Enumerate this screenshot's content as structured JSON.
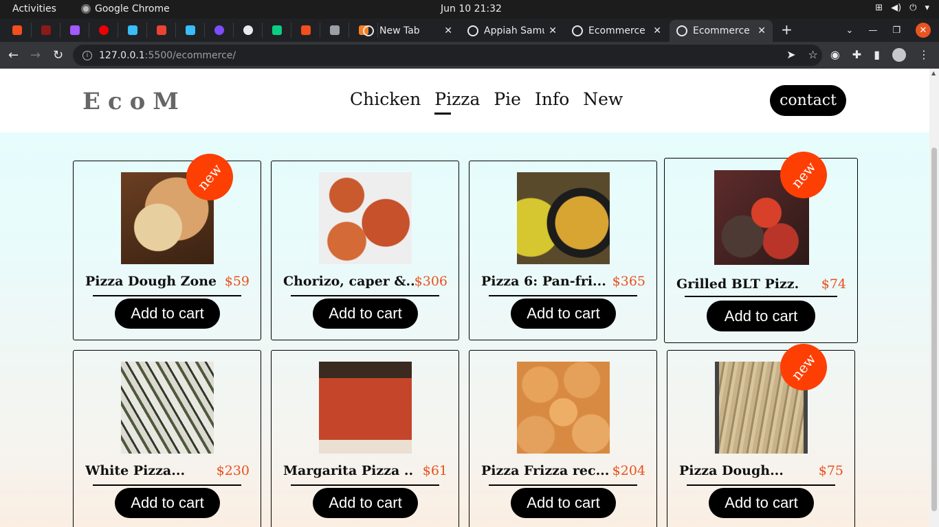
{
  "os_bar": {
    "activities": "Activities",
    "app_name": "Google Chrome",
    "clock": "Jun 10  21:32"
  },
  "browser": {
    "tabs": [
      {
        "title": "New Tab",
        "active": false
      },
      {
        "title": "Appiah Samu",
        "active": false
      },
      {
        "title": "Ecommerce",
        "active": false
      },
      {
        "title": "Ecommerce",
        "active": true
      }
    ],
    "url_host": "127.0.0.1",
    "url_path": ":5500/ecommerce/"
  },
  "site": {
    "logo": "EcoM",
    "menu": [
      "Chicken",
      "Pizza",
      "Pie",
      "Info",
      "New"
    ],
    "active_menu": "Pizza",
    "contact": "contact"
  },
  "products": [
    {
      "title": "Pizza Dough Zone...",
      "price": "$59",
      "badge": "new",
      "cta": "Add to cart"
    },
    {
      "title": "Chorizo, caper &...",
      "price": "$306",
      "badge": "",
      "cta": "Add to cart"
    },
    {
      "title": "Pizza 6: Pan-fri...",
      "price": "$365",
      "badge": "",
      "cta": "Add to cart"
    },
    {
      "title": "Grilled BLT Pizz...",
      "price": "$74",
      "badge": "new",
      "cta": "Add to cart"
    },
    {
      "title": "White Pizza...",
      "price": "$230",
      "badge": "",
      "cta": "Add to cart"
    },
    {
      "title": "Margarita Pizza ...",
      "price": "$61",
      "badge": "",
      "cta": "Add to cart"
    },
    {
      "title": "Pizza Frizza rec...",
      "price": "$204",
      "badge": "",
      "cta": "Add to cart"
    },
    {
      "title": "Pizza Dough...",
      "price": "$75",
      "badge": "new",
      "cta": "Add to cart"
    }
  ],
  "colors": {
    "accent": "#fd3f04",
    "price": "#e8501e",
    "button": "#000000"
  }
}
